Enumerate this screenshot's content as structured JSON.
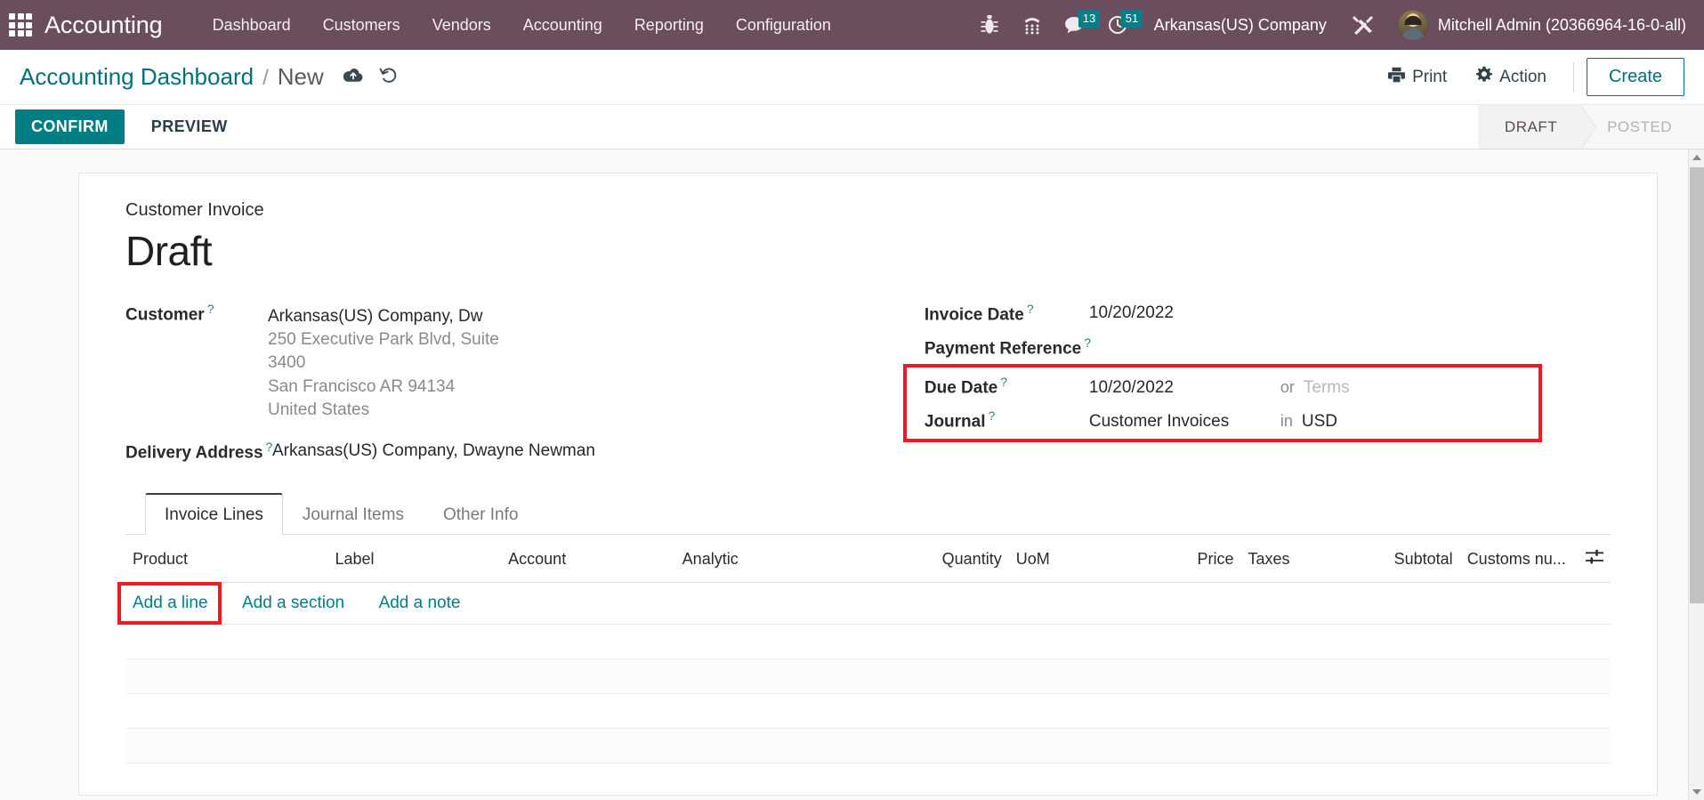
{
  "navbar": {
    "apps_icon": "apps-grid-icon",
    "brand": "Accounting",
    "menus": [
      {
        "label": "Dashboard"
      },
      {
        "label": "Customers"
      },
      {
        "label": "Vendors"
      },
      {
        "label": "Accounting"
      },
      {
        "label": "Reporting"
      },
      {
        "label": "Configuration"
      }
    ],
    "icons": [
      {
        "name": "bug-icon",
        "badge": null
      },
      {
        "name": "voip-dialpad-icon",
        "badge": null
      },
      {
        "name": "messages-icon",
        "badge": "13"
      },
      {
        "name": "activities-clock-icon",
        "badge": "51"
      }
    ],
    "company": "Arkansas(US) Company",
    "tools_icon": "tools-crossed-icon",
    "user": "Mitchell Admin (20366964-16-0-all)",
    "bg_color": "#6B4E5E",
    "badge_color": "#00808a"
  },
  "control_panel": {
    "breadcrumb_root": "Accounting Dashboard",
    "breadcrumb_sep": "/",
    "breadcrumb_current": "New",
    "save_icon": "cloud-upload-save-icon",
    "discard_icon": "undo-discard-icon",
    "print_label": "Print",
    "print_icon": "printer-icon",
    "action_label": "Action",
    "action_icon": "gear-icon",
    "create_label": "Create",
    "accent_color": "#00707f"
  },
  "statusbar": {
    "confirm_label": "CONFIRM",
    "preview_label": "PREVIEW",
    "primary_color": "#017e84",
    "stages": [
      {
        "label": "DRAFT",
        "active": true
      },
      {
        "label": "POSTED",
        "active": false
      }
    ]
  },
  "form": {
    "subtitle": "Customer Invoice",
    "title": "Draft",
    "left": {
      "customer_label": "Customer",
      "customer_value": "Arkansas(US) Company, Dw",
      "customer_address": [
        "250 Executive Park Blvd, Suite",
        "3400",
        "San Francisco AR 94134",
        "United States"
      ],
      "delivery_label": "Delivery Address",
      "delivery_value": "Arkansas(US) Company, Dwayne Newman"
    },
    "right": {
      "invoice_date_label": "Invoice Date",
      "invoice_date_value": "10/20/2022",
      "payment_reference_label": "Payment Reference",
      "payment_reference_value": "",
      "due_date_label": "Due Date",
      "due_date_value": "10/20/2022",
      "due_date_or": "or",
      "terms_placeholder": "Terms",
      "journal_label": "Journal",
      "journal_value": "Customer Invoices",
      "journal_in": "in",
      "currency_value": "USD"
    },
    "tooltip_marker": "?"
  },
  "notebook": {
    "tabs": [
      {
        "label": "Invoice Lines",
        "active": true
      },
      {
        "label": "Journal Items",
        "active": false
      },
      {
        "label": "Other Info",
        "active": false
      }
    ],
    "columns": [
      {
        "label": "Product",
        "align": "left"
      },
      {
        "label": "Label",
        "align": "left"
      },
      {
        "label": "Account",
        "align": "left"
      },
      {
        "label": "Analytic",
        "align": "left"
      },
      {
        "label": "Quantity",
        "align": "right"
      },
      {
        "label": "UoM",
        "align": "left"
      },
      {
        "label": "Price",
        "align": "right"
      },
      {
        "label": "Taxes",
        "align": "left"
      },
      {
        "label": "Subtotal",
        "align": "right"
      },
      {
        "label": "Customs nu...",
        "align": "left"
      }
    ],
    "optional_columns_icon": "sliders-toggle-icon",
    "add_line_label": "Add a line",
    "add_section_label": "Add a section",
    "add_note_label": "Add a note",
    "empty_row_count": 4
  },
  "annotations": {
    "highlight_color": "#ee1b24",
    "boxes": [
      {
        "name": "due-date-journal-highlight"
      },
      {
        "name": "add-a-line-highlight"
      }
    ]
  },
  "scrollbar": {
    "up_arrow": "scroll-up-arrow-icon",
    "down_arrow": "scroll-down-arrow-icon"
  }
}
